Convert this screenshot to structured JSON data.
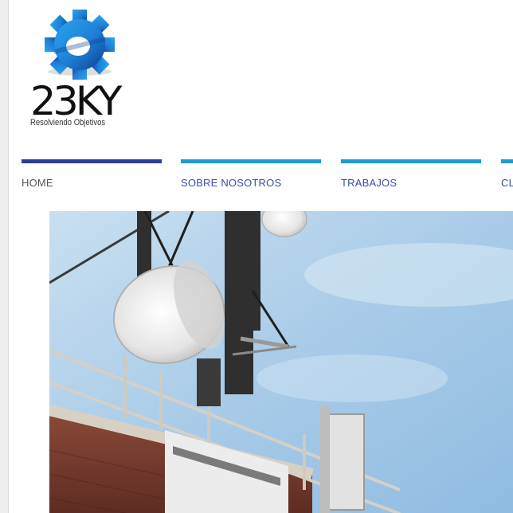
{
  "logo": {
    "text": "23KY",
    "tagline": "Resolviendo Objetivos"
  },
  "nav": {
    "items": [
      {
        "label": "HOME",
        "active": true,
        "bar_color": "#2b3f99",
        "text_color": "#555555"
      },
      {
        "label": "SOBRE NOSOTROS",
        "active": false,
        "bar_color": "#1f9ad6",
        "text_color": "#3c4da6"
      },
      {
        "label": "TRABAJOS",
        "active": false,
        "bar_color": "#1f9ad6",
        "text_color": "#3c4da6"
      },
      {
        "label": "CL",
        "active": false,
        "bar_color": "#1f9ad6",
        "text_color": "#3c4da6"
      }
    ]
  },
  "colors": {
    "gear_blue": "#1e88d8",
    "gear_dark": "#0d4f9c",
    "sky": "#a9cbe8"
  },
  "hero": {
    "icon": "telecom-antenna-photo"
  }
}
